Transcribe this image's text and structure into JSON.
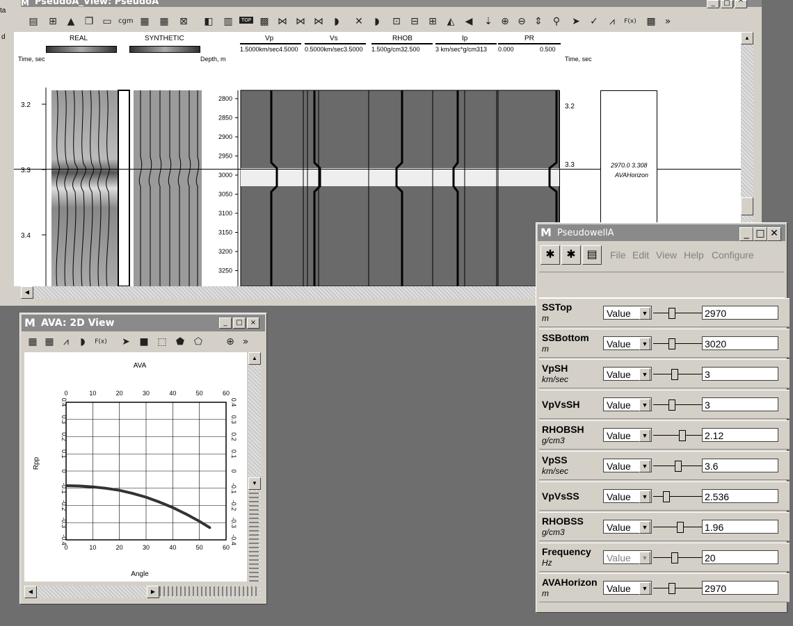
{
  "main_window": {
    "title": "PseudoA_View: PseudoA",
    "col_labels": {
      "real": "REAL",
      "synthetic": "SYNTHETIC"
    },
    "axis_labels": {
      "time_left": "Time, sec",
      "depth": "Depth, m",
      "time_right": "Time, sec"
    },
    "logs": [
      {
        "name": "Vp",
        "scale": "1.5000km/sec4.5000"
      },
      {
        "name": "Vs",
        "scale": "0.5000km/sec3.5000"
      },
      {
        "name": "RHOB",
        "scale": "1.500g/cm32.500"
      },
      {
        "name": "Ip",
        "scale": "3 km/sec*g/cm313"
      },
      {
        "name": "PR",
        "scale_min": "0.000",
        "scale_max": "0.500"
      }
    ],
    "time_ticks": [
      "3.2",
      "3.3",
      "3.4"
    ],
    "right_time_ticks": [
      "3.2",
      "3.3"
    ],
    "depth_ticks": [
      "2800",
      "2850",
      "2900",
      "2950",
      "3000",
      "3050",
      "3100",
      "3150",
      "3200",
      "3250"
    ],
    "annotation": {
      "value": "2970.0 3.308",
      "name": "AVAHorizon"
    },
    "toolbar_text": {
      "cgm": "cgm",
      "top": "TOP",
      "fx": "F(x)",
      "more": "»"
    }
  },
  "ava_window": {
    "title": "AVA: 2D View",
    "toolbar_text": {
      "fx": "F(x)",
      "more": "»"
    },
    "left_labels": [
      "ta",
      "d"
    ]
  },
  "chart_data": {
    "type": "line",
    "title": "AVA",
    "xlabel": "Angle",
    "ylabel": "Rpp",
    "xlim": [
      0,
      60
    ],
    "ylim": [
      -0.4,
      0.4
    ],
    "x_ticks": [
      "0",
      "10",
      "20",
      "30",
      "40",
      "50",
      "60"
    ],
    "y_ticks": [
      "0.4",
      "0.3",
      "0.2",
      "0.1",
      "0",
      "-0.1",
      "-0.2",
      "-0.3",
      "-0.4"
    ],
    "grid": true,
    "series": [
      {
        "x": [
          0,
          5,
          10,
          15,
          20,
          25,
          30,
          35,
          40,
          45,
          50,
          54
        ],
        "y": [
          -0.085,
          -0.087,
          -0.092,
          -0.1,
          -0.112,
          -0.13,
          -0.152,
          -0.18,
          -0.212,
          -0.25,
          -0.292,
          -0.33
        ]
      }
    ]
  },
  "pseudowell": {
    "title": "PseudowellA",
    "menu": [
      "File",
      "Edit",
      "View",
      "Help",
      "Configure"
    ],
    "params": [
      {
        "name": "SSTop",
        "unit": "m",
        "mode": "Value",
        "value": "2970",
        "level": 0.35
      },
      {
        "name": "SSBottom",
        "unit": "m",
        "mode": "Value",
        "value": "3020",
        "level": 0.35
      },
      {
        "name": "VpSH",
        "unit": "km/sec",
        "mode": "Value",
        "value": "3",
        "level": 0.42
      },
      {
        "name": "VpVsSH",
        "unit": "",
        "mode": "Value",
        "value": "3",
        "level": 0.35
      },
      {
        "name": "RHOBSH",
        "unit": "g/cm3",
        "mode": "Value",
        "value": "2.12",
        "level": 0.6
      },
      {
        "name": "VpSS",
        "unit": "km/sec",
        "mode": "Value",
        "value": "3.6",
        "level": 0.5
      },
      {
        "name": "VpVsSS",
        "unit": "",
        "mode": "Value",
        "value": "2.536",
        "level": 0.22
      },
      {
        "name": "RHOBSS",
        "unit": "g/cm3",
        "mode": "Value",
        "value": "1.96",
        "level": 0.55
      },
      {
        "name": "Frequency",
        "unit": "Hz",
        "mode": "Value",
        "value": "20",
        "level": 0.42
      },
      {
        "name": "AVAHorizon",
        "unit": "m",
        "mode": "Value",
        "value": "2970",
        "level": 0.35
      }
    ]
  },
  "colors": {
    "desktop": "#6e6e6e",
    "panel": "#d4d0c8",
    "log_fill": "#6a6a6a",
    "zone": "#eeeeee"
  }
}
